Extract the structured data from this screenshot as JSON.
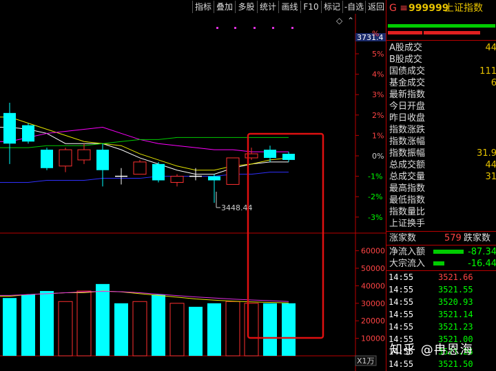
{
  "toolbar": {
    "buttons": [
      "指标",
      "叠加",
      "多股",
      "统计",
      "画线",
      "F10",
      "标记",
      "-自选",
      "返回"
    ]
  },
  "chart": {
    "price_label": "3731.4",
    "min_label": "3448.44",
    "percent_ticks": [
      "5%",
      "4%",
      "3%",
      "2%",
      "1%",
      "0%",
      "-1%",
      "-2%",
      "-3%"
    ],
    "top_pct_partial": "%",
    "volume_ticks": [
      "60000",
      "50000",
      "40000",
      "30000",
      "20000",
      "10000"
    ],
    "volume_unit": "X1万",
    "colors": {
      "up": "#ff3030",
      "down": "#00ffff",
      "ma1": "#ffffff",
      "ma2": "#e6e600",
      "ma3": "#ff00ff",
      "ma4": "#00cc00",
      "ma5": "#3030ff",
      "highlight": "#e01010"
    }
  },
  "chart_data": {
    "type": "candlestick",
    "series": [
      {
        "index": 1,
        "open": 0.6,
        "close": 2.1,
        "high": 2.6,
        "low": -0.4,
        "dir": "down"
      },
      {
        "index": 2,
        "open": 1.5,
        "close": 0.7,
        "high": 1.6,
        "low": 0.6,
        "dir": "down"
      },
      {
        "index": 3,
        "open": 0.3,
        "close": -0.6,
        "high": 0.4,
        "low": -0.7,
        "dir": "down"
      },
      {
        "index": 4,
        "open": -0.5,
        "close": 0.3,
        "high": 0.4,
        "low": -0.8,
        "dir": "up"
      },
      {
        "index": 5,
        "open": -0.2,
        "close": 0.3,
        "high": 0.6,
        "low": -0.4,
        "dir": "up"
      },
      {
        "index": 6,
        "open": 0.3,
        "close": -0.7,
        "high": 0.6,
        "low": -1.5,
        "dir": "down"
      },
      {
        "index": 7,
        "open": -1.0,
        "close": -1.0,
        "high": -0.6,
        "low": -1.4,
        "dir": "flat"
      },
      {
        "index": 8,
        "open": -0.9,
        "close": -0.3,
        "high": -0.2,
        "low": -0.9,
        "dir": "up"
      },
      {
        "index": 9,
        "open": -0.4,
        "close": -1.2,
        "high": -0.3,
        "low": -1.3,
        "dir": "down"
      },
      {
        "index": 10,
        "open": -1.3,
        "close": -1.0,
        "high": -0.9,
        "low": -1.5,
        "dir": "up"
      },
      {
        "index": 11,
        "open": -1.0,
        "close": -1.0,
        "high": -0.6,
        "low": -1.2,
        "dir": "flat"
      },
      {
        "index": 12,
        "open": -1.0,
        "close": -1.2,
        "high": -0.9,
        "low": -2.3,
        "dir": "down"
      },
      {
        "index": 13,
        "open": -1.4,
        "close": -0.1,
        "high": -0.1,
        "low": -1.4,
        "dir": "up"
      },
      {
        "index": 14,
        "open": -0.1,
        "close": 0.1,
        "high": 0.4,
        "low": -0.2,
        "dir": "up"
      },
      {
        "index": 15,
        "open": 0.3,
        "close": -0.1,
        "high": 0.5,
        "low": -0.3,
        "dir": "down"
      },
      {
        "index": 16,
        "open": 0.1,
        "close": -0.2,
        "high": 0.2,
        "low": -0.3,
        "dir": "down"
      }
    ],
    "volume": [
      33000,
      35000,
      37000,
      31000,
      37000,
      41000,
      30000,
      31000,
      35000,
      30000,
      28000,
      30000,
      31000,
      30000,
      30000,
      30000
    ],
    "volume_dir": [
      "down",
      "down",
      "down",
      "up",
      "up",
      "down",
      "down",
      "up",
      "down",
      "up",
      "down",
      "down",
      "up",
      "up",
      "down",
      "down"
    ],
    "y_pct_range": [
      -3.3,
      6.0
    ],
    "vol_range": [
      0,
      65000
    ]
  },
  "right_panel": {
    "code_prefix": "G ≡",
    "code": "999999",
    "name": "上证指数",
    "rows": [
      {
        "label": "A股成交",
        "value": "44"
      },
      {
        "label": "B股成交",
        "value": ""
      },
      {
        "label": "国债成交",
        "value": "111"
      },
      {
        "label": "基金成交",
        "value": "6"
      },
      {
        "label": "最新指数",
        "value": ""
      },
      {
        "label": "今日开盘",
        "value": ""
      },
      {
        "label": "昨日收盘",
        "value": ""
      },
      {
        "label": "指数涨跌",
        "value": ""
      },
      {
        "label": "指数涨幅",
        "value": ""
      },
      {
        "label": "指数振幅",
        "value": "31.9"
      },
      {
        "label": "总成交额",
        "value": "44"
      },
      {
        "label": "总成交量",
        "value": "31"
      },
      {
        "label": "最高指数",
        "value": ""
      },
      {
        "label": "最低指数",
        "value": ""
      },
      {
        "label": "指数量比",
        "value": ""
      },
      {
        "label": "上证换手",
        "value": ""
      }
    ],
    "rise_label": "涨家数",
    "rise_value": "579",
    "fall_label": "跌家数",
    "netflow_label": "净流入额",
    "netflow_value": "-87.34",
    "bigflow_label": "大宗流入",
    "bigflow_value": "-16.44",
    "trades": [
      {
        "time": "14:55",
        "price": "3521.66",
        "color": "red"
      },
      {
        "time": "14:55",
        "price": "3521.55",
        "color": "green"
      },
      {
        "time": "14:55",
        "price": "3520.93",
        "color": "green"
      },
      {
        "time": "14:55",
        "price": "3521.14",
        "color": "green"
      },
      {
        "time": "14:55",
        "price": "3521.23",
        "color": "green"
      },
      {
        "time": "14:55",
        "price": "3521.00",
        "color": "green"
      },
      {
        "time": "14:55",
        "price": "3521.26",
        "color": "green"
      },
      {
        "time": "14:55",
        "price": "3521.50",
        "color": "green"
      }
    ]
  },
  "watermark": "知乎 @冉恩海"
}
